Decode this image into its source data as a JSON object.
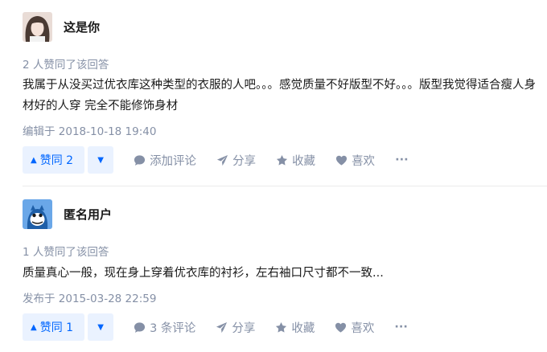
{
  "answers": [
    {
      "author": {
        "name": "这是你",
        "avatar": "female-portrait-avatar"
      },
      "upvote_count_text": "2 人赞同了该回答",
      "content": "我属于从没买过优衣库这种类型的衣服的人吧。。。感觉质量不好版型不好。。。版型我觉得适合瘦人身材好的人穿 完全不能修饰身材",
      "time_text": "编辑于 2018-10-18 19:40",
      "actions": {
        "upvote_label": "赞同 2",
        "comment_label": "添加评论",
        "share_label": "分享",
        "collect_label": "收藏",
        "like_label": "喜欢",
        "more_label": "···"
      }
    },
    {
      "author": {
        "name": "匿名用户",
        "avatar": "anonymous-blue-avatar"
      },
      "upvote_count_text": "1 人赞同了该回答",
      "content": "质量真心一般，现在身上穿着优衣库的衬衫，左右袖口尺寸都不一致...",
      "time_text": "发布于 2015-03-28 22:59",
      "actions": {
        "upvote_label": "赞同 1",
        "comment_label": "3 条评论",
        "share_label": "分享",
        "collect_label": "收藏",
        "like_label": "喜欢",
        "more_label": "···"
      }
    }
  ],
  "colors": {
    "accent": "#0066ff",
    "accent_bg": "#eaf2ff",
    "meta_gray": "#8590a6"
  },
  "icons": [
    "triangle-up-icon",
    "triangle-down-icon",
    "comment-icon",
    "share-icon",
    "star-icon",
    "heart-icon",
    "more-icon"
  ]
}
